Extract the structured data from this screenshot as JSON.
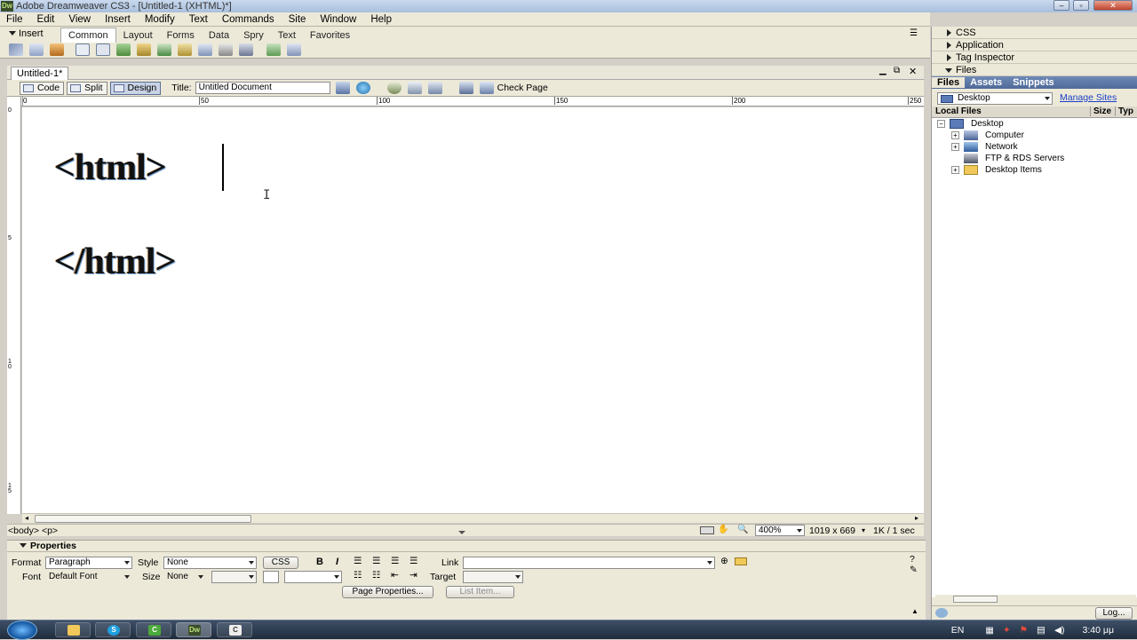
{
  "window": {
    "title": "Adobe Dreamweaver CS3 - [Untitled-1 (XHTML)*]",
    "logo": "Dw"
  },
  "menu": [
    "File",
    "Edit",
    "View",
    "Insert",
    "Modify",
    "Text",
    "Commands",
    "Site",
    "Window",
    "Help"
  ],
  "insert_bar": {
    "label": "Insert",
    "tabs": [
      "Common",
      "Layout",
      "Forms",
      "Data",
      "Spry",
      "Text",
      "Favorites"
    ],
    "active_tab": "Common"
  },
  "document": {
    "tab": "Untitled-1*",
    "views": [
      "Code",
      "Split",
      "Design"
    ],
    "active_view": "Design",
    "title_label": "Title:",
    "title_value": "Untitled Document",
    "check_page": "Check Page",
    "ruler_top": [
      "0",
      "50",
      "100",
      "150",
      "200",
      "250"
    ],
    "ruler_left": [
      "0",
      "5",
      "1 0",
      "1 5"
    ],
    "content_open": "<html>",
    "content_close": "</html>"
  },
  "status": {
    "tag_selector": "<body> <p>",
    "zoom": "400%",
    "size": "1019 x 669",
    "download": "1K / 1 sec"
  },
  "properties": {
    "header": "Properties",
    "format_label": "Format",
    "format_value": "Paragraph",
    "style_label": "Style",
    "style_value": "None",
    "css_button": "CSS",
    "link_label": "Link",
    "font_label": "Font",
    "font_value": "Default Font",
    "size_label": "Size",
    "size_value": "None",
    "target_label": "Target",
    "page_properties": "Page Properties...",
    "list_item": "List Item..."
  },
  "right_panel": {
    "groups": [
      "CSS",
      "Application",
      "Tag Inspector",
      "Files"
    ],
    "file_tabs": [
      "Files",
      "Assets",
      "Snippets"
    ],
    "active_file_tab": "Files",
    "site": "Desktop",
    "manage_sites": "Manage Sites",
    "columns": {
      "name": "Local Files",
      "size": "Size",
      "type": "Typ"
    },
    "tree": [
      {
        "label": "Desktop",
        "level": 0
      },
      {
        "label": "Computer",
        "level": 1
      },
      {
        "label": "Network",
        "level": 1
      },
      {
        "label": "FTP & RDS Servers",
        "level": 1
      },
      {
        "label": "Desktop Items",
        "level": 1
      }
    ],
    "log_button": "Log..."
  },
  "taskbar": {
    "lang": "EN",
    "time": "3:40 μμ"
  },
  "colors": {
    "accent": "#4f6a98",
    "chrome": "#ece9d8",
    "link": "#1a3fc7"
  }
}
